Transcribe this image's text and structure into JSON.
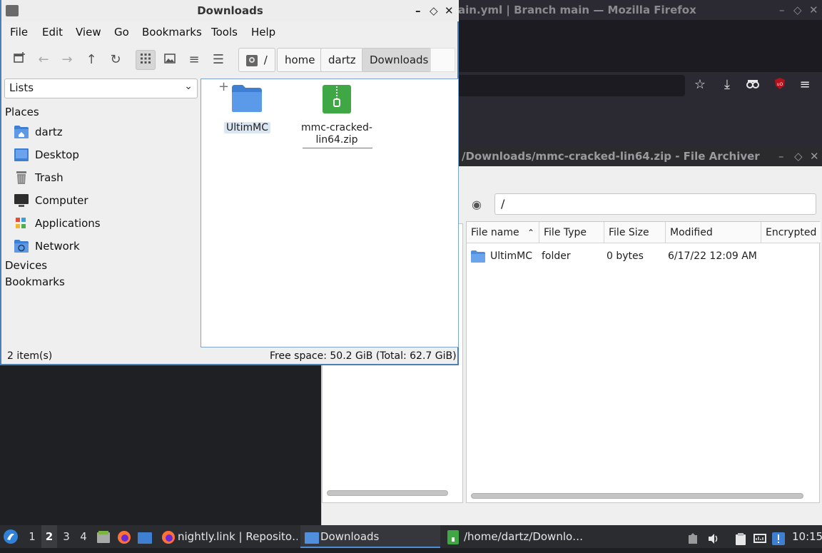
{
  "firefox": {
    "title": "ain.yml | Branch main — Mozilla Firefox",
    "window_buttons": [
      "–",
      "◇",
      "✕"
    ]
  },
  "archiver": {
    "title": "/Downloads/mmc-cracked-lin64.zip - File Archiver",
    "window_buttons": [
      "–",
      "◇",
      "✕"
    ],
    "location_value": "/",
    "columns": [
      "File name",
      "File Type",
      "File Size",
      "Modified",
      "Encrypted"
    ],
    "rows": [
      {
        "name": "UltimMC",
        "type": "folder",
        "size": "0 bytes",
        "modified": "6/17/22 12:09 AM",
        "encrypted": ""
      }
    ]
  },
  "downloads": {
    "title": "Downloads",
    "window_buttons": [
      "–",
      "◇",
      "✕"
    ],
    "menu": [
      "File",
      "Edit",
      "View",
      "Go",
      "Bookmarks",
      "Tools",
      "Help"
    ],
    "path_root": "/",
    "breadcrumbs": [
      "home",
      "dartz",
      "Downloads"
    ],
    "sidebar_mode": "Lists",
    "places_heading": "Places",
    "places": [
      {
        "label": "dartz",
        "icon": "home-folder-icon"
      },
      {
        "label": "Desktop",
        "icon": "desktop-icon"
      },
      {
        "label": "Trash",
        "icon": "trash-icon"
      },
      {
        "label": "Computer",
        "icon": "computer-icon"
      },
      {
        "label": "Applications",
        "icon": "applications-icon"
      },
      {
        "label": "Network",
        "icon": "network-icon"
      }
    ],
    "devices_heading": "Devices",
    "bookmarks_heading": "Bookmarks",
    "files": [
      {
        "name": "UltimMC",
        "kind": "folder"
      },
      {
        "name": "mmc-cracked-lin64.zip",
        "line1": "mmc-cracked-",
        "line2": "lin64.zip",
        "kind": "zip"
      }
    ],
    "status_count": "2 item(s)",
    "status_space": "Free space: 50.2 GiB (Total: 62.7 GiB)"
  },
  "taskbar": {
    "workspaces": [
      "1",
      "2",
      "3",
      "4"
    ],
    "active_workspace": "2",
    "tasks": [
      {
        "label": "nightly.link | Reposito…",
        "icon": "firefox-icon"
      },
      {
        "label": "Downloads",
        "icon": "folder-icon"
      },
      {
        "label": "/home/dartz/Downlo…",
        "icon": "archive-icon"
      }
    ],
    "clock": "10:15"
  },
  "colors": {
    "accent": "#4a7fb8",
    "folder_blue": "#4f8fde",
    "zip_green": "#3fa845",
    "taskbar_bg": "#2a2c30"
  }
}
